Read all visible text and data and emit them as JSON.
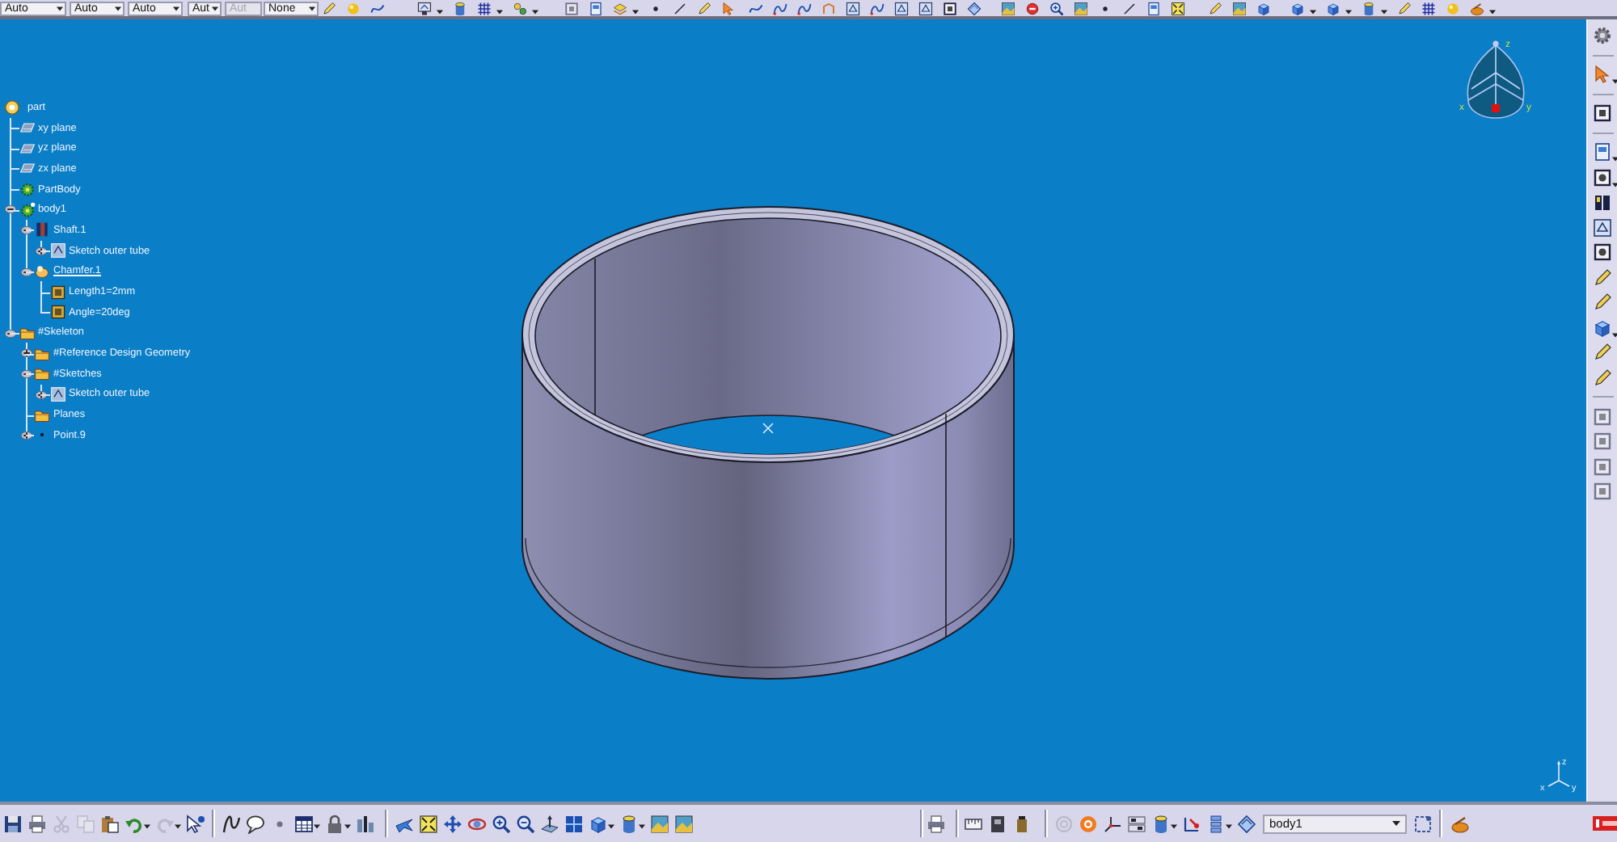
{
  "top_toolbar": {
    "dropdowns": [
      {
        "value": "Auto",
        "disabled": false
      },
      {
        "value": "Auto",
        "disabled": false
      },
      {
        "value": "Auto",
        "disabled": false
      },
      {
        "value": "Aut",
        "disabled": false
      },
      {
        "value": "Aut",
        "disabled": true
      },
      {
        "value": "None",
        "disabled": false
      }
    ]
  },
  "tree": {
    "root": {
      "label": "part",
      "kind": "part",
      "expandable": false,
      "expanded": true,
      "current": false,
      "children": [
        {
          "label": "xy plane",
          "kind": "plane",
          "expandable": false,
          "expanded": false,
          "current": false
        },
        {
          "label": "yz plane",
          "kind": "plane",
          "expandable": false,
          "expanded": false,
          "current": false
        },
        {
          "label": "zx plane",
          "kind": "plane",
          "expandable": false,
          "expanded": false,
          "current": false
        },
        {
          "label": "PartBody",
          "kind": "partbody",
          "expandable": false,
          "expanded": false,
          "current": false
        },
        {
          "label": "body1",
          "kind": "body",
          "expandable": true,
          "expanded": true,
          "current": false,
          "children": [
            {
              "label": "Shaft.1",
              "kind": "shaft",
              "expandable": true,
              "expanded": true,
              "current": false,
              "children": [
                {
                  "label": "Sketch outer tube",
                  "kind": "sketch",
                  "expandable": true,
                  "expanded": false,
                  "current": false
                }
              ]
            },
            {
              "label": "Chamfer.1",
              "kind": "chamfer",
              "expandable": true,
              "expanded": true,
              "current": true,
              "children": [
                {
                  "label": "Length1=2mm",
                  "kind": "parameter",
                  "expandable": false,
                  "expanded": false,
                  "current": false
                },
                {
                  "label": "Angle=20deg",
                  "kind": "parameter",
                  "expandable": false,
                  "expanded": false,
                  "current": false
                }
              ]
            }
          ]
        },
        {
          "label": "#Skeleton",
          "kind": "skeleton",
          "expandable": true,
          "expanded": true,
          "current": false,
          "children": [
            {
              "label": "#Reference Design Geometry",
              "kind": "skeleton",
              "expandable": true,
              "expanded": false,
              "current": false
            },
            {
              "label": "#Sketches",
              "kind": "skeleton",
              "expandable": true,
              "expanded": true,
              "current": false,
              "children": [
                {
                  "label": "Sketch outer tube",
                  "kind": "sketch",
                  "expandable": true,
                  "expanded": false,
                  "current": false
                }
              ]
            },
            {
              "label": "Planes",
              "kind": "skeleton",
              "expandable": false,
              "expanded": false,
              "current": false
            },
            {
              "label": "Point.9",
              "kind": "point",
              "expandable": true,
              "expanded": false,
              "current": false
            }
          ]
        }
      ]
    }
  },
  "compass": {
    "labels": [
      "z",
      "x",
      "y"
    ]
  },
  "axis_triad": {
    "labels": [
      "z",
      "x",
      "y"
    ]
  },
  "bottom_toolbar": {
    "body_selector": {
      "value": "body1"
    }
  }
}
